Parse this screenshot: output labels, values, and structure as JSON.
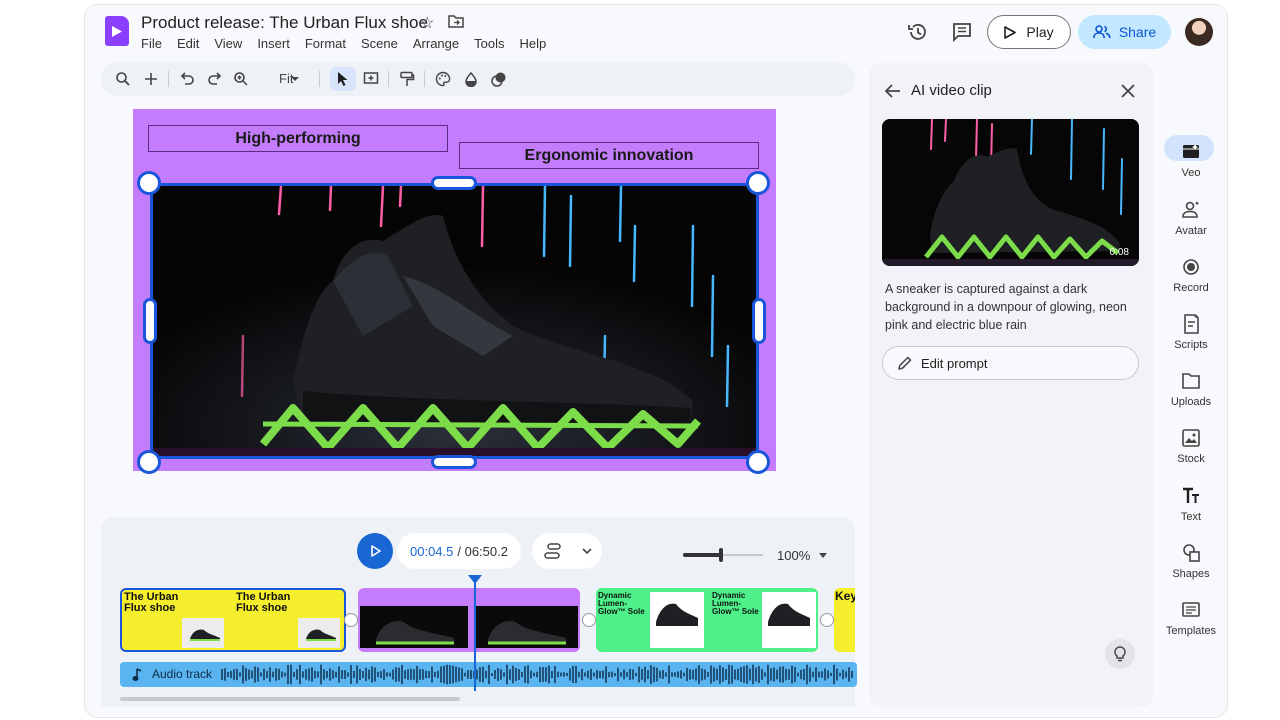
{
  "header": {
    "doc_title": "Product release: The Urban Flux shoe",
    "menu": [
      "File",
      "Edit",
      "View",
      "Insert",
      "Format",
      "Scene",
      "Arrange",
      "Tools",
      "Help"
    ],
    "play_label": "Play",
    "share_label": "Share"
  },
  "toolbar": {
    "zoom_fit": "Fit"
  },
  "canvas": {
    "label_left": "High-performing",
    "label_right": "Ergonomic innovation"
  },
  "timeline": {
    "current_time": "00:04.5",
    "total_time": "/ 06:50.2",
    "zoom": "100%",
    "zoom_level": 0.48,
    "audio_track_label": "Audio track",
    "clips": {
      "clip1_title_a": "The Urban Flux shoe",
      "clip1_title_b": "The Urban Flux shoe",
      "clip3_title_a": "Dynamic Lumen-Glow™ Sole",
      "clip3_title_b": "Dynamic Lumen-Glow™ Sole",
      "clip4_title": "Key"
    }
  },
  "panel": {
    "title": "AI video clip",
    "duration": "0:08",
    "description": "A sneaker is captured against a dark background in a downpour of glowing, neon pink and electric blue rain",
    "edit_prompt_label": "Edit prompt"
  },
  "rail": {
    "items": [
      "Veo",
      "Avatar",
      "Record",
      "Scripts",
      "Uploads",
      "Stock",
      "Text",
      "Shapes",
      "Templates"
    ]
  },
  "colors": {
    "brand_purple": "#8a3ffc",
    "slide_bg": "#c27cfc",
    "selection_blue": "#1a56db",
    "share_bg": "#c2e7ff",
    "clip_yellow": "#f5ee2c",
    "clip_green": "#4ef08a",
    "audio_blue": "#5ab4f0"
  }
}
